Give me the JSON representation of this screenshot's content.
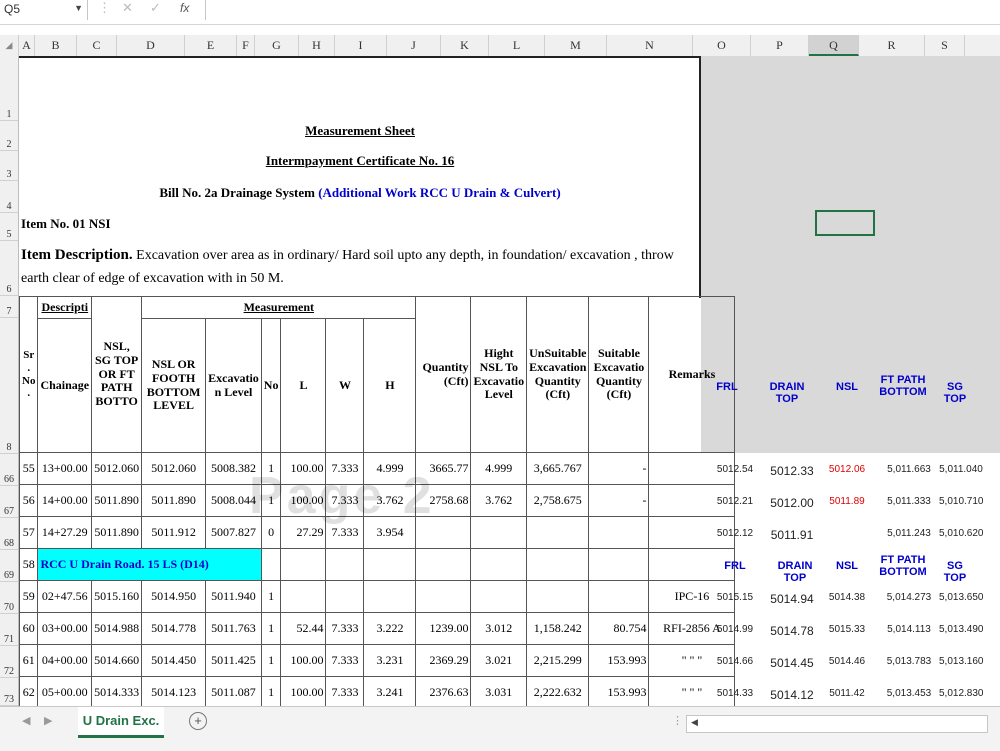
{
  "formula_bar": {
    "name_box": "Q5",
    "fx": "fx"
  },
  "columns": [
    "A",
    "B",
    "C",
    "D",
    "E",
    "F",
    "G",
    "H",
    "I",
    "J",
    "K",
    "L",
    "M",
    "N",
    "O",
    "P",
    "Q",
    "R",
    "S"
  ],
  "row_numbers": [
    "1",
    "2",
    "3",
    "4",
    "5",
    "6",
    "7",
    "8",
    "66",
    "67",
    "68",
    "69",
    "70",
    "71",
    "72",
    "73"
  ],
  "title": {
    "line1": "Measurement Sheet",
    "line2": "Intermpayment Certificate No. 16",
    "line3a": "Bill No. 2a Drainage System",
    "line3b": "(Additional Work RCC U Drain & Culvert)",
    "item_no": "Item No. 01 NSI",
    "desc_label": "Item Description.",
    "desc_text": "Excavation over area as in ordinary/ Hard soil upto any depth, in foundation/ excavation , throw earth clear of edge of excavation with in 50 M."
  },
  "headers": {
    "sr": "Sr . No .",
    "descripti": "Descripti",
    "chainage": "Chainage",
    "nsl_sg": "NSL, SG TOP OR FT PATH BOTTO",
    "measurement": "Measurement",
    "nsl_footh": "NSL OR FOOTH BOTTOM LEVEL",
    "excavation_level": "Excavatio n Level",
    "no": "No",
    "l": "L",
    "w": "W",
    "h": "H",
    "quantity": "Quantity (Cft)",
    "hight": "Hight NSL To Excavatio Level",
    "unsuitable": "UnSuitable Excavation Quantity (Cft)",
    "suitable": "Suitable Excavatio Quantity (Cft)",
    "remarks": "Remarks"
  },
  "right_headers": {
    "frl": "FRL",
    "drain_top": "DRAIN TOP",
    "nsl": "NSL",
    "ft_path": "FT PATH BOTTOM",
    "sg_top": "SG TOP"
  },
  "rows": [
    {
      "sr": "55",
      "chainage": "13+00.00",
      "c": "5012.060",
      "d": "5012.060",
      "e": "5008.382",
      "no": "1",
      "l": "100.00",
      "w": "7.333",
      "h": "4.999",
      "qty": "3665.77",
      "hight": "4.999",
      "uns": "3,665.767",
      "sui": "-",
      "rem": "",
      "frl": "5012.54",
      "drain": "5012.33",
      "nsl": "5012.06",
      "ft": "5,011.663",
      "sg": "5,011.040",
      "nsl_red": true
    },
    {
      "sr": "56",
      "chainage": "14+00.00",
      "c": "5011.890",
      "d": "5011.890",
      "e": "5008.044",
      "no": "1",
      "l": "100.00",
      "w": "7.333",
      "h": "3.762",
      "qty": "2758.68",
      "hight": "3.762",
      "uns": "2,758.675",
      "sui": "-",
      "rem": "",
      "frl": "5012.21",
      "drain": "5012.00",
      "nsl": "5011.89",
      "ft": "5,011.333",
      "sg": "5,010.710",
      "nsl_red": true
    },
    {
      "sr": "57",
      "chainage": "14+27.29",
      "c": "5011.890",
      "d": "5011.912",
      "e": "5007.827",
      "no": "0",
      "l": "27.29",
      "w": "7.333",
      "h": "3.954",
      "qty": "",
      "hight": "",
      "uns": "",
      "sui": "",
      "rem": "",
      "frl": "5012.12",
      "drain": "5011.91",
      "nsl": "",
      "ft": "5,011.243",
      "sg": "5,010.620",
      "nsl_red": false
    },
    {
      "section": "RCC U Drain Road. 15 LS (D14)",
      "sr": "58"
    },
    {
      "sr": "59",
      "chainage": "02+47.56",
      "c": "5015.160",
      "d": "5014.950",
      "e": "5011.940",
      "no": "1",
      "l": "",
      "w": "",
      "h": "",
      "qty": "",
      "hight": "",
      "uns": "",
      "sui": "",
      "rem": "IPC-16",
      "frl": "5015.15",
      "drain": "5014.94",
      "nsl": "5014.38",
      "ft": "5,014.273",
      "sg": "5,013.650",
      "nsl_red": false
    },
    {
      "sr": "60",
      "chainage": "03+00.00",
      "c": "5014.988",
      "d": "5014.778",
      "e": "5011.763",
      "no": "1",
      "l": "52.44",
      "w": "7.333",
      "h": "3.222",
      "qty": "1239.00",
      "hight": "3.012",
      "uns": "1,158.242",
      "sui": "80.754",
      "rem": "RFI-2856 A",
      "frl": "5014.99",
      "drain": "5014.78",
      "nsl": "5015.33",
      "ft": "5,014.113",
      "sg": "5,013.490",
      "nsl_red": false
    },
    {
      "sr": "61",
      "chainage": "04+00.00",
      "c": "5014.660",
      "d": "5014.450",
      "e": "5011.425",
      "no": "1",
      "l": "100.00",
      "w": "7.333",
      "h": "3.231",
      "qty": "2369.29",
      "hight": "3.021",
      "uns": "2,215.299",
      "sui": "153.993",
      "rem": "\" \" \"",
      "frl": "5014.66",
      "drain": "5014.45",
      "nsl": "5014.46",
      "ft": "5,013.783",
      "sg": "5,013.160",
      "nsl_red": false
    },
    {
      "sr": "62",
      "chainage": "05+00.00",
      "c": "5014.333",
      "d": "5014.123",
      "e": "5011.087",
      "no": "1",
      "l": "100.00",
      "w": "7.333",
      "h": "3.241",
      "qty": "2376.63",
      "hight": "3.031",
      "uns": "2,222.632",
      "sui": "153.993",
      "rem": "\" \" \"",
      "frl": "5014.33",
      "drain": "5014.12",
      "nsl": "5011.42",
      "ft": "5,013.453",
      "sg": "5,012.830",
      "nsl_red": false
    }
  ],
  "sheet_tab": "U Drain Exc.",
  "watermark": "Page 2",
  "colors": {
    "accent": "#217346",
    "cyan": "#00ffff",
    "blue_text": "#0000cc",
    "red_text": "#e00000"
  }
}
